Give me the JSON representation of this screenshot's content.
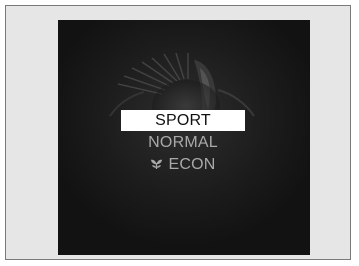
{
  "drive_modes": {
    "items": [
      {
        "label": "SPORT",
        "selected": true
      },
      {
        "label": "NORMAL",
        "selected": false
      },
      {
        "label": "ECON",
        "selected": false,
        "icon": "eco-leaf-icon"
      }
    ]
  },
  "colors": {
    "screen_background": "#141414",
    "selected_background": "#ffffff",
    "selected_text": "#111111",
    "unselected_text": "#a9a9a9",
    "frame_background": "#e6e6e6"
  }
}
